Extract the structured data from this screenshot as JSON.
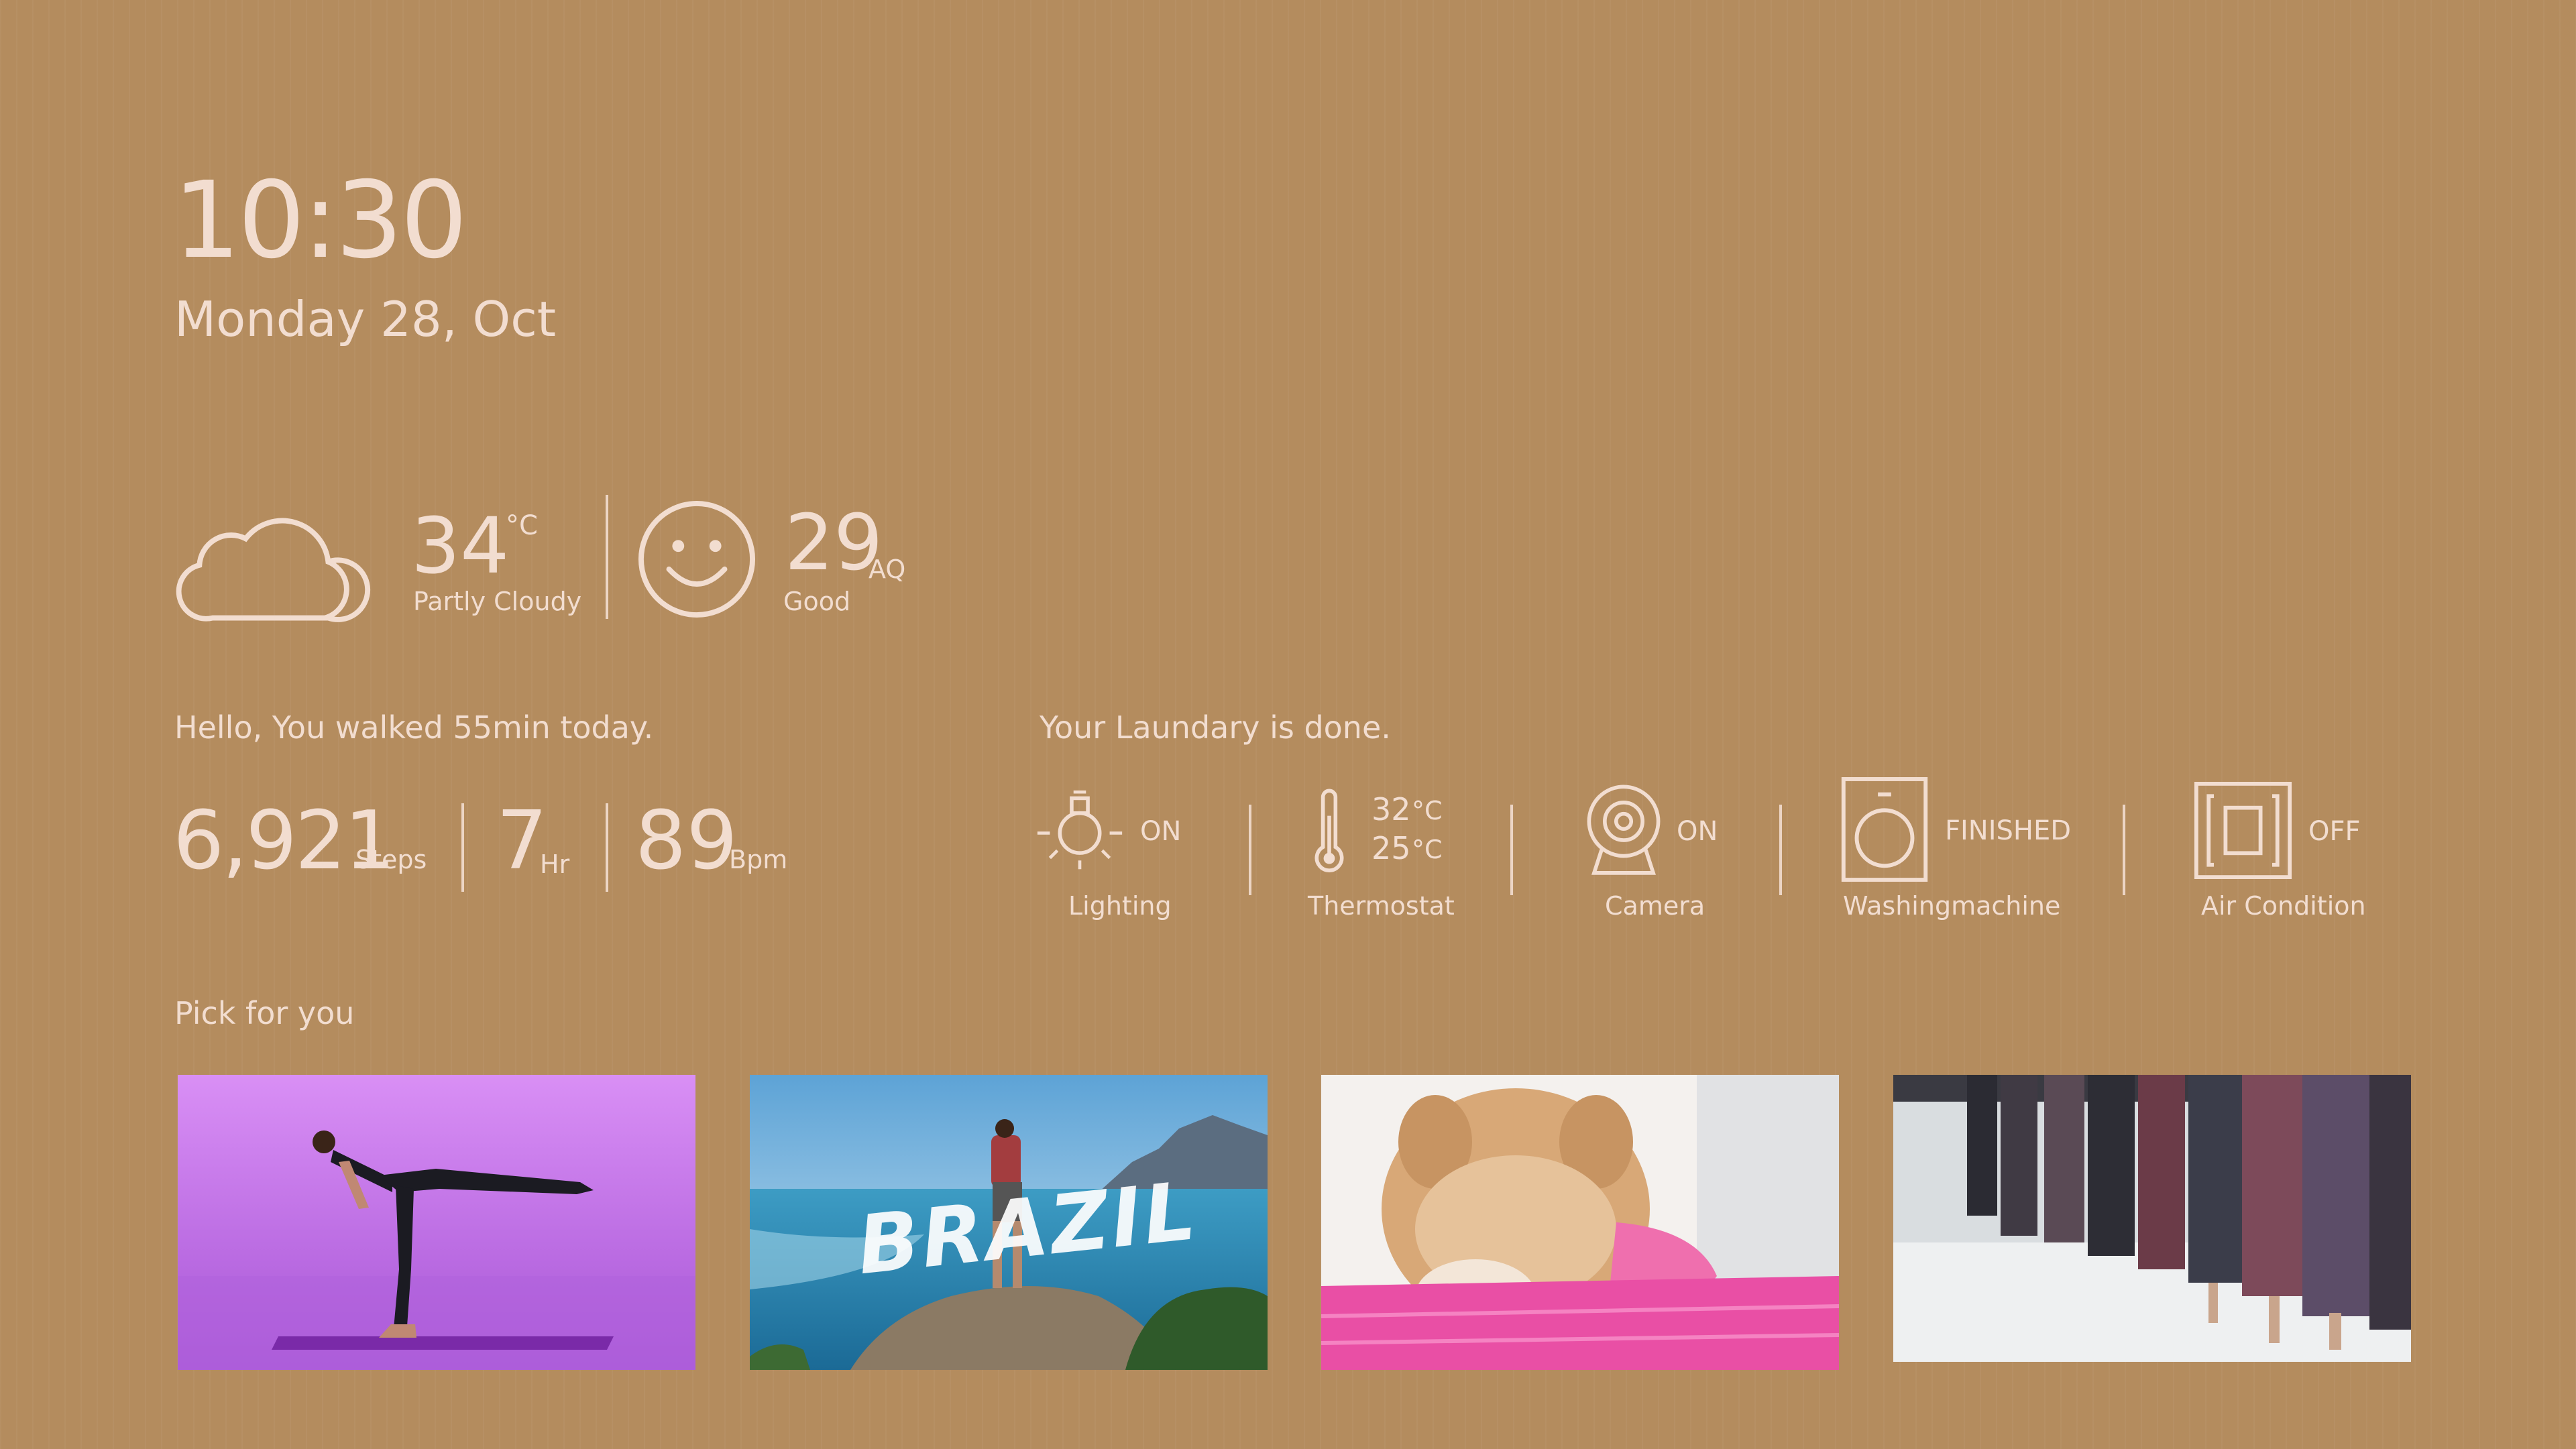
{
  "clock": {
    "time": "10:30",
    "date": "Monday 28, Oct"
  },
  "weather": {
    "icon": "cloud-icon",
    "temperature": "34",
    "unit": "°C",
    "condition": "Partly Cloudy"
  },
  "air_quality": {
    "icon": "smiley-face-icon",
    "value": "29",
    "unit": "AQ",
    "label": "Good"
  },
  "activity": {
    "greeting": "Hello, You walked 55min today.",
    "steps": {
      "value": "6,921",
      "unit": "Steps"
    },
    "sleep": {
      "value": "7",
      "unit": "Hr"
    },
    "heart_rate": {
      "value": "89",
      "unit": "Bpm"
    }
  },
  "home": {
    "message": "Your Laundary is done.",
    "devices": [
      {
        "name": "Lighting",
        "icon": "light-bulb-icon",
        "status": "ON"
      },
      {
        "name": "Thermostat",
        "icon": "thermometer-icon",
        "high": "32",
        "low": "25",
        "unit": "°C"
      },
      {
        "name": "Camera",
        "icon": "camera-icon",
        "status": "ON"
      },
      {
        "name": "Washingmachine",
        "icon": "washing-machine-icon",
        "status": "FINISHED"
      },
      {
        "name": "Air Condition",
        "icon": "air-conditioner-icon",
        "status": "OFF"
      }
    ]
  },
  "picks": {
    "title": "Pick for you",
    "items": [
      {
        "icon": "yoga-pose-image"
      },
      {
        "icon": "brazil-travel-image",
        "caption": "BRAZIL"
      },
      {
        "icon": "puppy-image"
      },
      {
        "icon": "fashion-runway-image"
      }
    ]
  },
  "colors": {
    "background": "#b48c5e",
    "foreground": "#f2ddd0"
  }
}
